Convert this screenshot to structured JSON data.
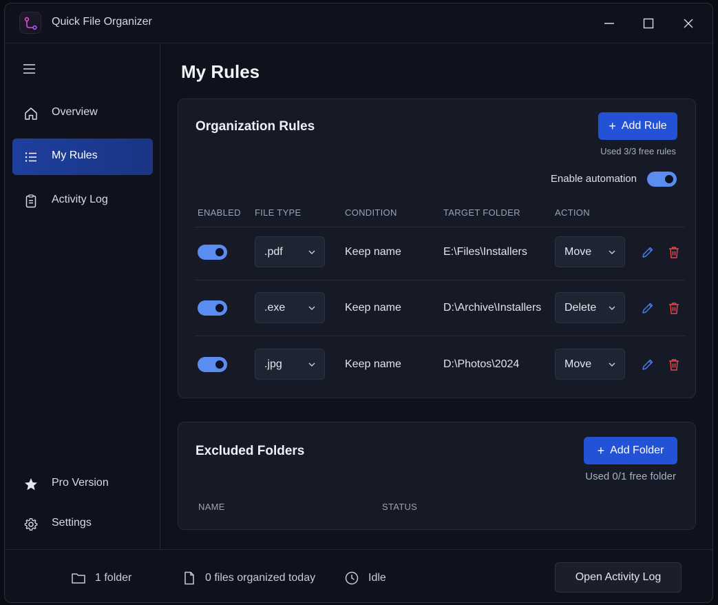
{
  "window": {
    "title": "Quick File Organizer"
  },
  "sidebar": {
    "items": [
      {
        "label": "Overview",
        "icon": "home-icon"
      },
      {
        "label": "My Rules",
        "icon": "list-icon",
        "active": true
      },
      {
        "label": "Activity Log",
        "icon": "clipboard-icon"
      },
      {
        "label": "Pro Version",
        "icon": "star-icon"
      },
      {
        "label": "Settings",
        "icon": "gear-icon"
      }
    ]
  },
  "main": {
    "title": "My Rules",
    "rules_card": {
      "title": "Organization Rules",
      "add_button": "Add Rule",
      "usage": "Used 3/3 free rules",
      "automation_label": "Enable automation",
      "automation_enabled": true,
      "columns": [
        "ENABLED",
        "FILE TYPE",
        "CONDITION",
        "TARGET FOLDER",
        "ACTION"
      ],
      "rows": [
        {
          "enabled": true,
          "file_type": ".pdf",
          "condition": "Keep name",
          "target": "E:\\Files\\Installers",
          "action": "Move"
        },
        {
          "enabled": true,
          "file_type": ".exe",
          "condition": "Keep name",
          "target": "D:\\Archive\\Installers",
          "action": "Delete"
        },
        {
          "enabled": true,
          "file_type": ".jpg",
          "condition": "Keep name",
          "target": "D:\\Photos\\2024",
          "action": "Move"
        }
      ]
    },
    "excluded_card": {
      "title": "Excluded Folders",
      "add_button": "Add Folder",
      "usage": "Used 0/1 free folder",
      "columns": [
        "NAME",
        "STATUS"
      ]
    }
  },
  "statusbar": {
    "folders": "1 folder",
    "files_today": "0 files organized today",
    "state": "Idle",
    "open_log_button": "Open Activity Log"
  },
  "colors": {
    "accent": "#2452d6",
    "toggle_on": "#5b8cf0",
    "edit": "#4a7df0",
    "delete": "#e5484d"
  }
}
